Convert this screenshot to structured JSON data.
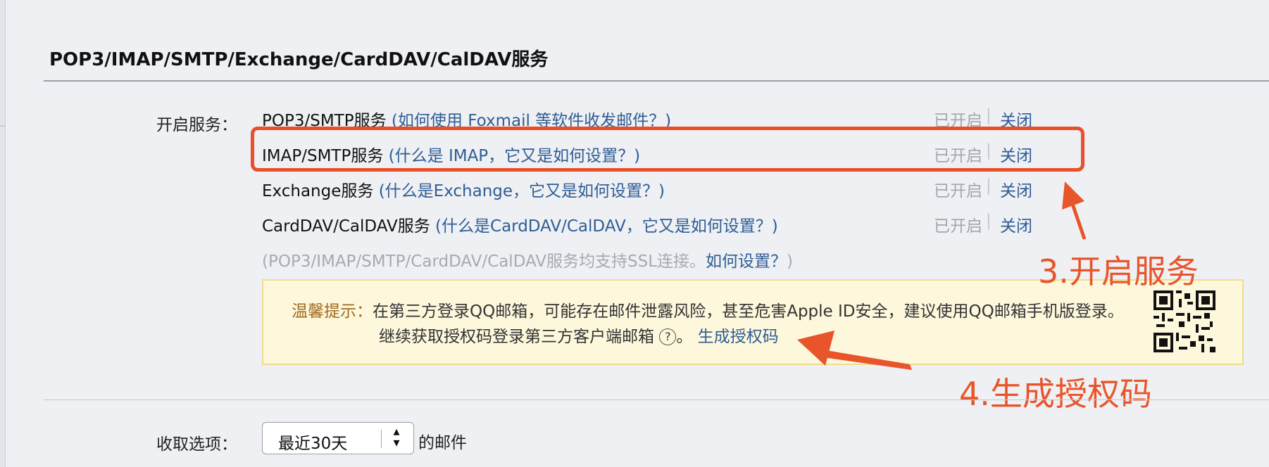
{
  "section": {
    "title": "POP3/IMAP/SMTP/Exchange/CardDAV/CalDAV服务"
  },
  "labels": {
    "services": "开启服务：",
    "fetch": "收取选项："
  },
  "services": [
    {
      "name": "POP3/SMTP服务",
      "help": "(如何使用 Foxmail 等软件收发邮件？)",
      "status": "已开启",
      "sep": "|",
      "action": "关闭"
    },
    {
      "name": "IMAP/SMTP服务",
      "help": "(什么是 IMAP，它又是如何设置？)",
      "status": "已开启",
      "sep": "|",
      "action": "关闭"
    },
    {
      "name": "Exchange服务",
      "help": "(什么是Exchange，它又是如何设置？)",
      "status": "已开启",
      "sep": "|",
      "action": "关闭"
    },
    {
      "name": "CardDAV/CalDAV服务",
      "help": "(什么是CardDAV/CalDAV，它又是如何设置？)",
      "status": "已开启",
      "sep": "|",
      "action": "关闭"
    }
  ],
  "ssl_note": {
    "text": "(POP3/IMAP/SMTP/CardDAV/CalDAV服务均支持SSL连接。",
    "link": "如何设置？",
    "close": ")"
  },
  "tip": {
    "heading": "温馨提示：",
    "line1": "在第三方登录QQ邮箱，可能存在邮件泄露风险，甚至危害Apple ID安全，建议使用QQ邮箱手机版登录。",
    "line2": "继续获取授权码登录第三方客户端邮箱",
    "help_glyph": "?",
    "period": "。",
    "generate_link": "生成授权码"
  },
  "annotations": {
    "step3": "3.开启服务",
    "step4": "4.生成授权码"
  },
  "fetch": {
    "value": "最近30天",
    "arrow_up": "▴",
    "arrow_down": "▾",
    "suffix": "的邮件"
  },
  "icons": {
    "qr": "qr-code-icon",
    "help": "help-circle-icon"
  },
  "colors": {
    "annotation": "#e8502a",
    "link": "#2f5d95",
    "tip_bg": "#fdf7dc"
  }
}
